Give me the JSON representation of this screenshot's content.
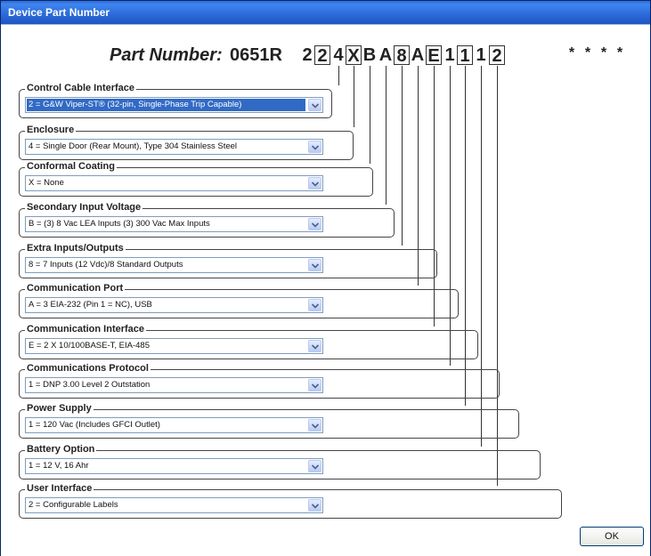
{
  "window": {
    "title": "Device Part Number"
  },
  "part_number": {
    "label": "Part Number:",
    "prefix": "0651R",
    "digits": [
      "2",
      "2",
      "4",
      "X",
      "B",
      "A",
      "8",
      "A",
      "E",
      "1",
      "1",
      "1",
      "2"
    ],
    "stars": [
      "*",
      "*",
      "*",
      "*"
    ]
  },
  "groups": [
    {
      "title": "Control Cable Interface",
      "value": "2 = G&W Viper-ST® (32-pin, Single-Phase Trip Capable)",
      "selected": true
    },
    {
      "title": "Enclosure",
      "value": "4 = Single Door (Rear Mount), Type 304 Stainless Steel",
      "selected": false
    },
    {
      "title": "Conformal Coating",
      "value": "X = None",
      "selected": false
    },
    {
      "title": "Secondary Input Voltage",
      "value": "B = (3) 8 Vac LEA Inputs (3) 300 Vac Max Inputs",
      "selected": false
    },
    {
      "title": "Extra Inputs/Outputs",
      "value": "8 = 7 Inputs (12 Vdc)/8 Standard Outputs",
      "selected": false
    },
    {
      "title": "Communication Port",
      "value": "A = 3 EIA-232 (Pin 1 = NC), USB",
      "selected": false
    },
    {
      "title": "Communication Interface",
      "value": "E = 2 X 10/100BASE-T, EIA-485",
      "selected": false
    },
    {
      "title": "Communications Protocol",
      "value": "1 = DNP 3.00 Level 2 Outstation",
      "selected": false
    },
    {
      "title": "Power Supply",
      "value": "1 = 120 Vac (Includes GFCI Outlet)",
      "selected": false
    },
    {
      "title": "Battery Option",
      "value": "1 = 12 V, 16 Ahr",
      "selected": false
    },
    {
      "title": "User Interface",
      "value": "2 = Configurable Labels",
      "selected": false
    }
  ],
  "ok_label": "OK"
}
